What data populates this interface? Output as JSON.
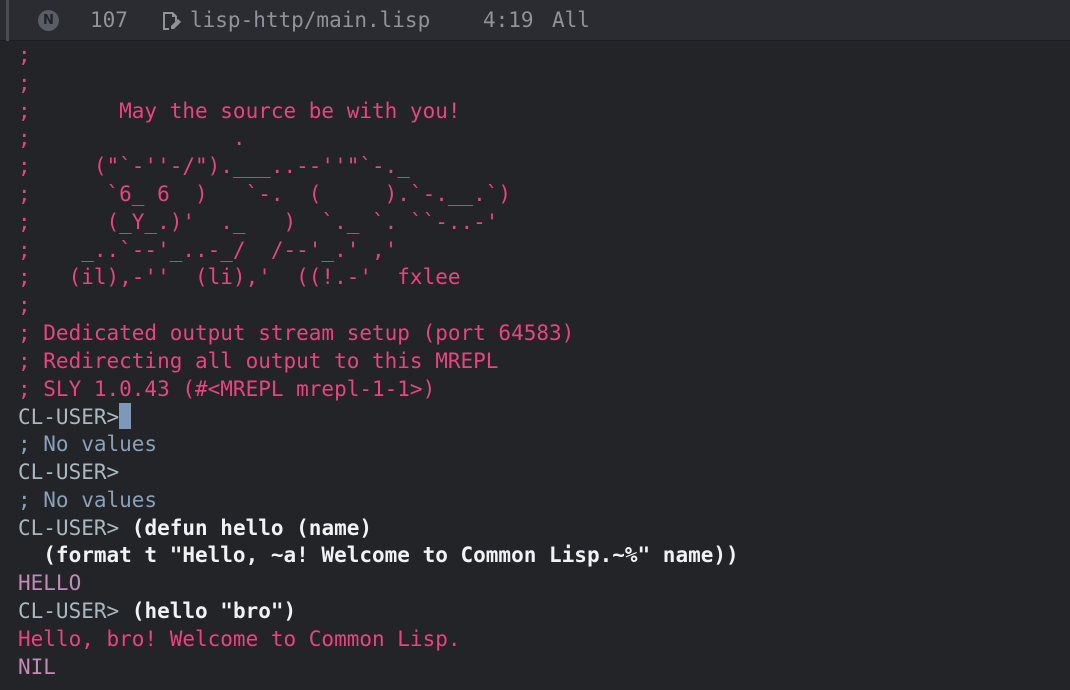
{
  "modeline": {
    "badge": "N",
    "line_count": "107",
    "buffer_name": "lisp-http/main.lisp",
    "position": "4:19",
    "scroll": "All",
    "icons": [
      "edit-file-icon"
    ]
  },
  "banner": [
    ";",
    ";",
    ";       May the source be with you!",
    ";                .",
    ";     (\"`-''-/\").___..--''\"`-._",
    ";      `6_ 6  )   `-.  (     ).`-.__.`)",
    ";      (_Y_.)'  ._   )  `._ `. ``-..-'",
    ";    _..`--'_..-_/  /--'_.' ,'",
    ";   (il),-''  (li),'  ((!.-'  fxlee",
    ";"
  ],
  "repl": {
    "setup_lines": [
      "; Dedicated output stream setup (port 64583)",
      "; Redirecting all output to this MREPL",
      "; SLY 1.0.43 (#<MREPL mrepl-1-1>)"
    ],
    "prompt": "CL-USER>",
    "prompt_space": "CL-USER> ",
    "no_values": "; No values",
    "defun_line1": "(defun hello (name)",
    "defun_line2": "  (format t \"Hello, ~a! Welcome to Common Lisp.~%\" name))",
    "defun_result": "HELLO",
    "call_input": "(hello \"bro\")",
    "call_output": "Hello, bro! Welcome to Common Lisp.",
    "call_result": "NIL"
  },
  "colors": {
    "background": "#232428",
    "comment": "#e8457f",
    "prompt": "#aab9c0",
    "no_values": "#8aa0b8",
    "result": "#c18ab8",
    "cursor": "#7e98b8"
  }
}
